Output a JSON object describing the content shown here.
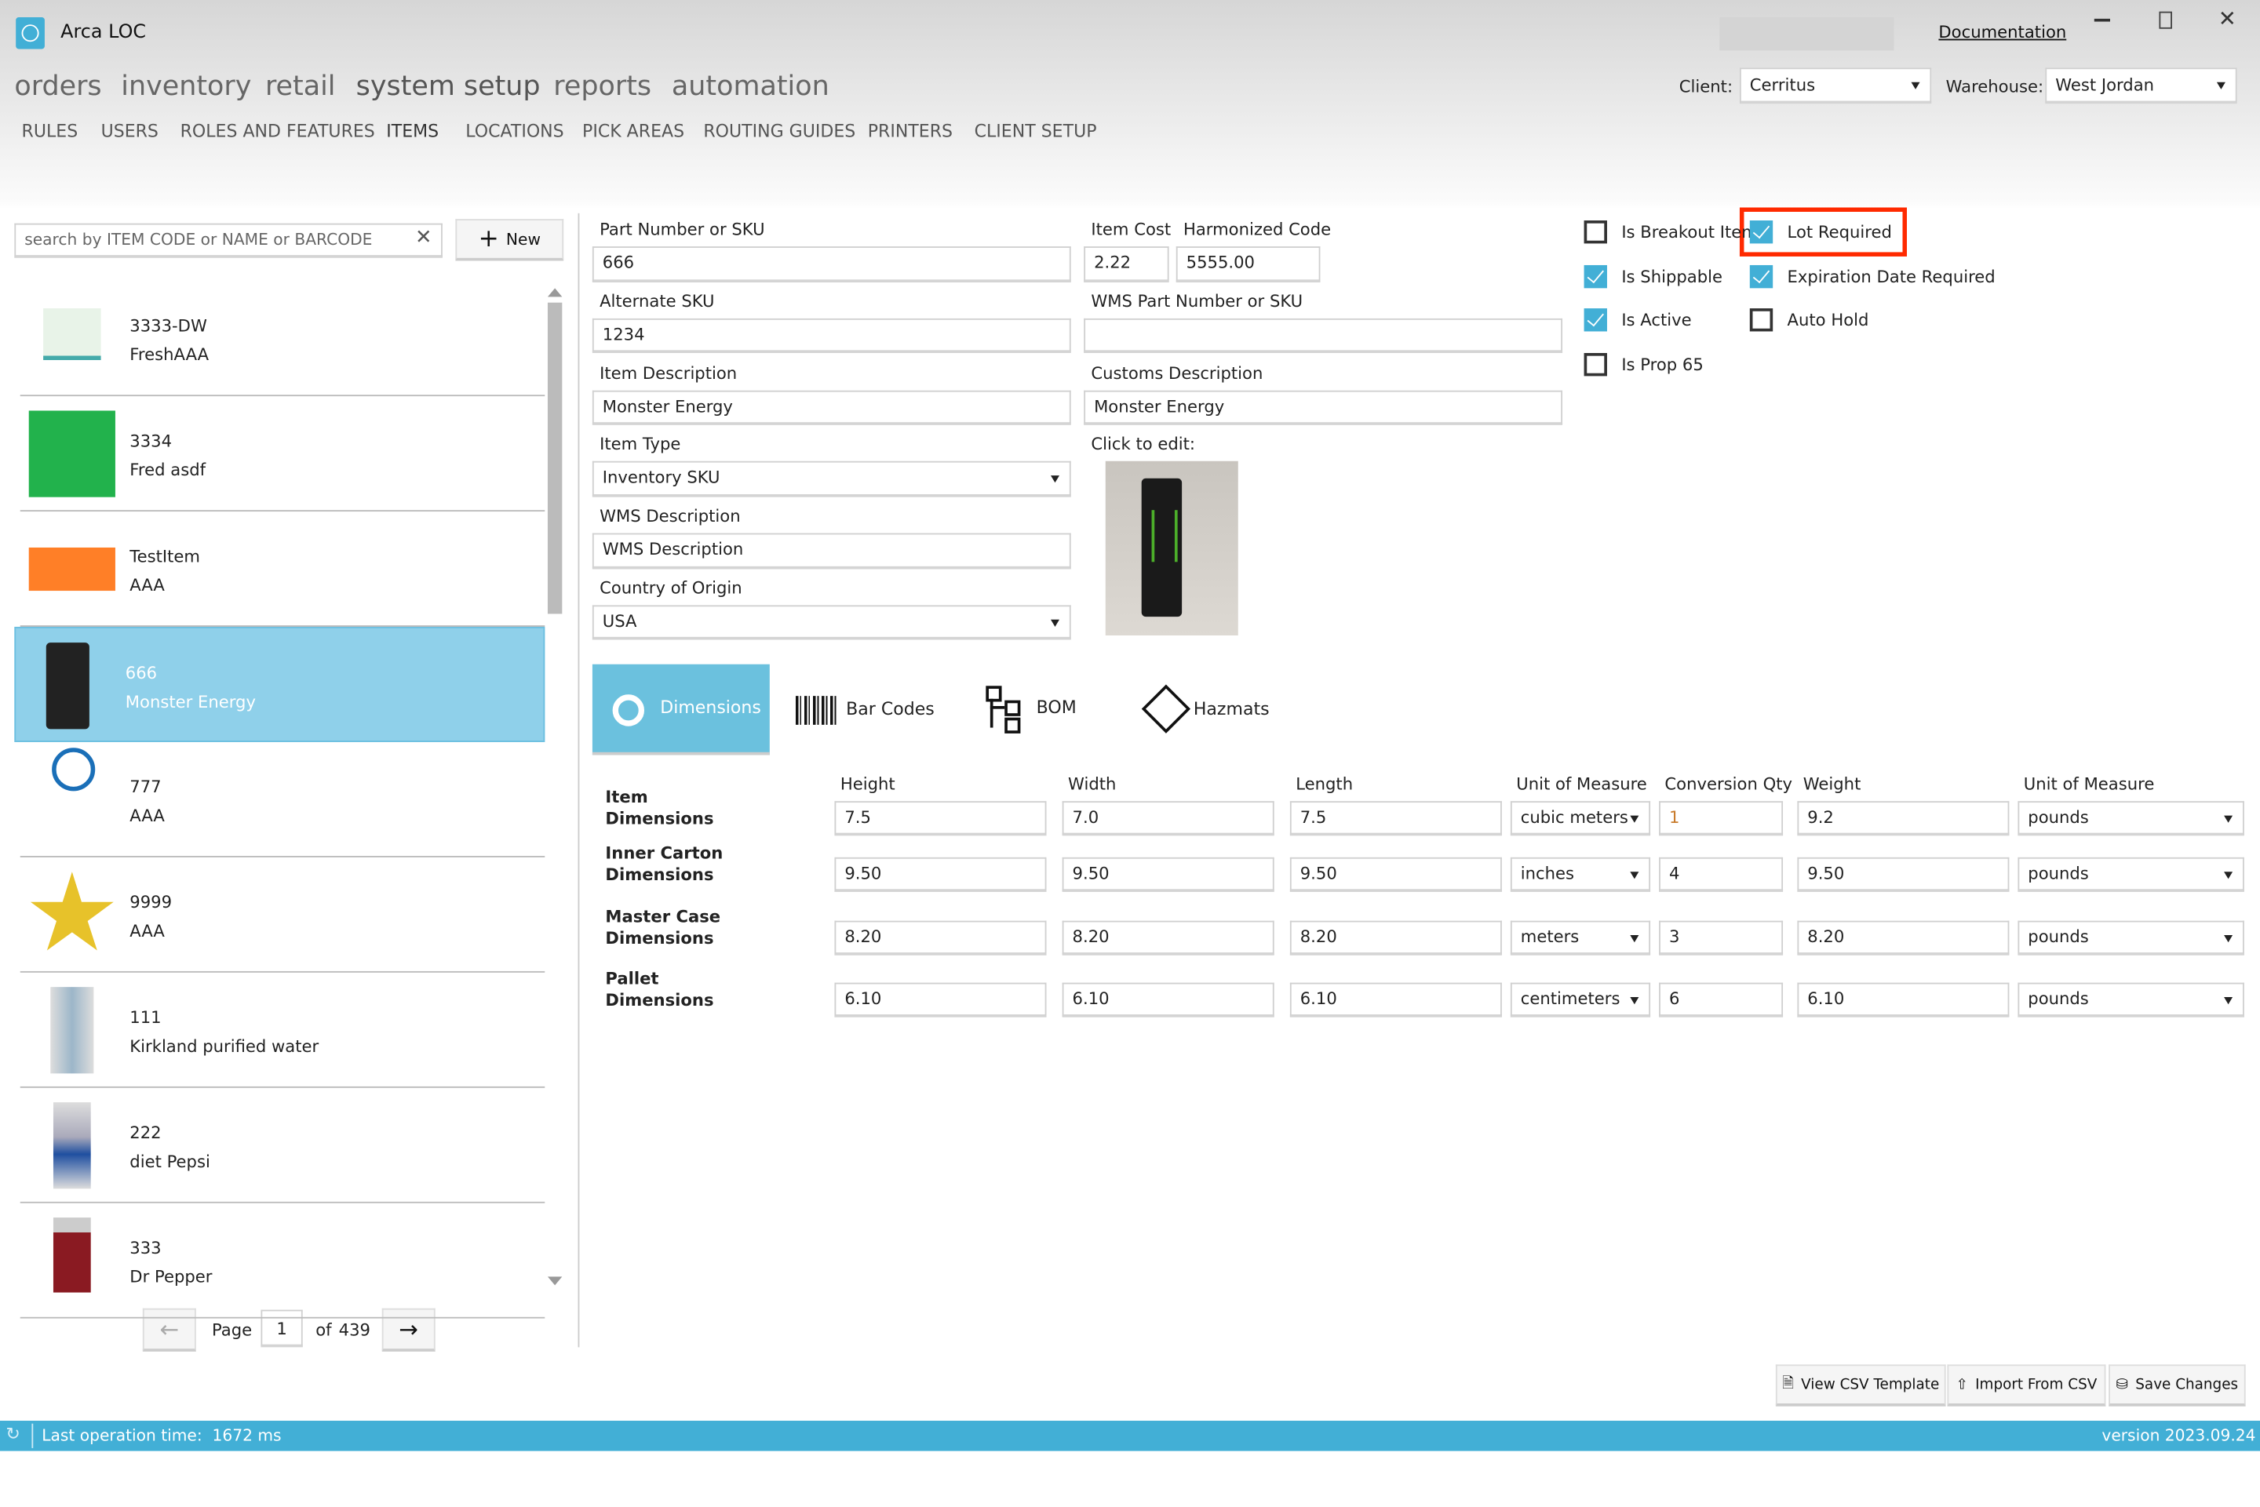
{
  "app": {
    "title": "Arca LOC",
    "documentation_link": "Documentation"
  },
  "main_nav": [
    "orders",
    "inventory",
    "retail",
    "system setup",
    "reports",
    "automation"
  ],
  "sub_nav": [
    "RULES",
    "USERS",
    "ROLES AND FEATURES",
    "ITEMS",
    "LOCATIONS",
    "PICK AREAS",
    "ROUTING GUIDES",
    "PRINTERS",
    "CLIENT SETUP"
  ],
  "client": {
    "label": "Client:",
    "value": "Cerritus"
  },
  "warehouse": {
    "label": "Warehouse:",
    "value": "West Jordan"
  },
  "search": {
    "placeholder": "search by ITEM CODE or NAME or BARCODE",
    "value": ""
  },
  "new_button": "New",
  "items": [
    {
      "code": "3333-DW",
      "name": "FreshAAA",
      "thumb": "fastblast-tub"
    },
    {
      "code": "3334",
      "name": "Fred asdf",
      "thumb": "green-swatch",
      "color": "#22b24c"
    },
    {
      "code": "TestItem",
      "name": "AAA",
      "thumb": "orange-swatch",
      "color": "#ff7f27"
    },
    {
      "code": "666",
      "name": "Monster Energy",
      "thumb": "monster-can",
      "selected": true
    },
    {
      "code": "777",
      "name": "AAA",
      "thumb": "dell-logo"
    },
    {
      "code": "9999",
      "name": "AAA",
      "thumb": "gold-star"
    },
    {
      "code": "111",
      "name": "Kirkland purified water",
      "thumb": "water-bottle"
    },
    {
      "code": "222",
      "name": "diet Pepsi",
      "thumb": "pepsi-can"
    },
    {
      "code": "333",
      "name": "Dr Pepper",
      "thumb": "drpepper-can"
    }
  ],
  "pagination": {
    "page_label": "Page",
    "page": "1",
    "of_label": "of",
    "total": "439"
  },
  "form": {
    "part_number": {
      "label": "Part Number or SKU",
      "value": "666"
    },
    "item_cost": {
      "label": "Item Cost",
      "value": "2.22"
    },
    "harmonized_code": {
      "label": "Harmonized Code",
      "value": "5555.00"
    },
    "alternate_sku": {
      "label": "Alternate SKU",
      "value": "1234"
    },
    "wms_part_number": {
      "label": "WMS Part Number or SKU",
      "value": ""
    },
    "item_description": {
      "label": "Item Description",
      "value": "Monster Energy"
    },
    "customs_description": {
      "label": "Customs Description",
      "value": "Monster Energy"
    },
    "item_type": {
      "label": "Item Type",
      "value": "Inventory SKU"
    },
    "wms_description": {
      "label": "WMS Description",
      "value": "WMS Description"
    },
    "country_of_origin": {
      "label": "Country of Origin",
      "value": "USA"
    },
    "image_label": "Click to edit:"
  },
  "checkboxes": [
    {
      "label": "Is Breakout Item",
      "checked": false
    },
    {
      "label": "Lot Required",
      "checked": true,
      "highlighted": true
    },
    {
      "label": "Is Shippable",
      "checked": true
    },
    {
      "label": "Expiration Date Required",
      "checked": true
    },
    {
      "label": "Is Active",
      "checked": true
    },
    {
      "label": "Auto Hold",
      "checked": false
    },
    {
      "label": "Is Prop 65",
      "checked": false
    }
  ],
  "tabs": [
    {
      "label": "Dimensions",
      "icon": "dimensions-icon",
      "active": true
    },
    {
      "label": "Bar Codes",
      "icon": "barcode-icon"
    },
    {
      "label": "BOM",
      "icon": "bom-icon"
    },
    {
      "label": "Hazmats",
      "icon": "hazmat-diamond-icon"
    }
  ],
  "dimensions": {
    "headers": [
      "Height",
      "Width",
      "Length",
      "Unit of Measure",
      "Conversion Qty",
      "Weight",
      "Unit of Measure"
    ],
    "rows": [
      {
        "label": "Item Dimensions",
        "values": [
          "7.5",
          "7.0",
          "7.5",
          "cubic meters",
          "1",
          "9.2",
          "pounds"
        ]
      },
      {
        "label": "Inner Carton Dimensions",
        "values": [
          "9.50",
          "9.50",
          "9.50",
          "inches",
          "4",
          "9.50",
          "pounds"
        ]
      },
      {
        "label": "Master Case Dimensions",
        "values": [
          "8.20",
          "8.20",
          "8.20",
          "meters",
          "3",
          "8.20",
          "pounds"
        ]
      },
      {
        "label": "Pallet Dimensions",
        "values": [
          "6.10",
          "6.10",
          "6.10",
          "centimeters",
          "6",
          "6.10",
          "pounds"
        ]
      }
    ]
  },
  "actions": [
    "View CSV Template",
    "Import From CSV",
    "Save Changes"
  ],
  "status": {
    "text": "Last operation time:  1672 ms",
    "version": "version 2023.09.24"
  },
  "colors": {
    "accent": "#42afd6",
    "highlight": "#ff2a00",
    "selected_row": "#8fd0ea"
  }
}
